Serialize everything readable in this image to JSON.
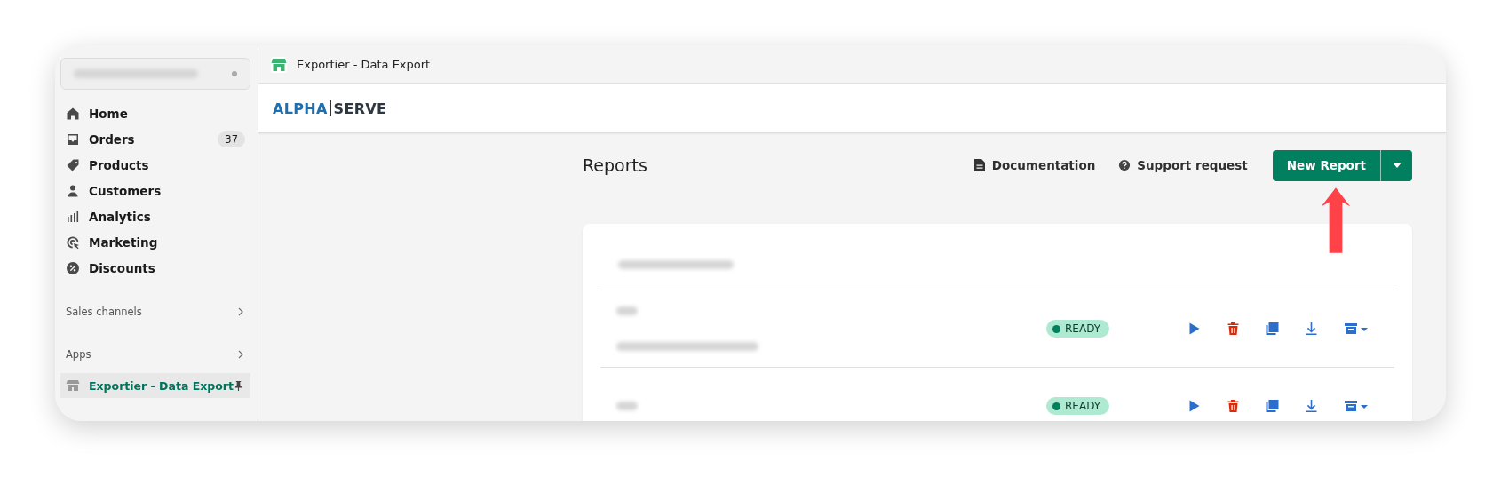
{
  "sidebar": {
    "nav": [
      {
        "label": "Home",
        "selected": false
      },
      {
        "label": "Orders",
        "badge": "37",
        "selected": false
      },
      {
        "label": "Products",
        "selected": false
      },
      {
        "label": "Customers",
        "selected": false
      },
      {
        "label": "Analytics",
        "selected": false
      },
      {
        "label": "Marketing",
        "selected": false
      },
      {
        "label": "Discounts",
        "selected": false
      }
    ],
    "sections": [
      {
        "label": "Sales channels"
      },
      {
        "label": "Apps",
        "items": [
          {
            "label": "Exportier - Data Export",
            "selected": true
          }
        ]
      }
    ]
  },
  "top_bar": {
    "title": "Exportier - Data Export"
  },
  "logo": {
    "left": "ALPHA",
    "right": "SERVE"
  },
  "page": {
    "title": "Reports",
    "links": [
      "Documentation",
      "Support request"
    ],
    "primary_button": "New Report"
  },
  "reports": [
    {
      "status": "READY"
    },
    {
      "status": "READY"
    }
  ]
}
